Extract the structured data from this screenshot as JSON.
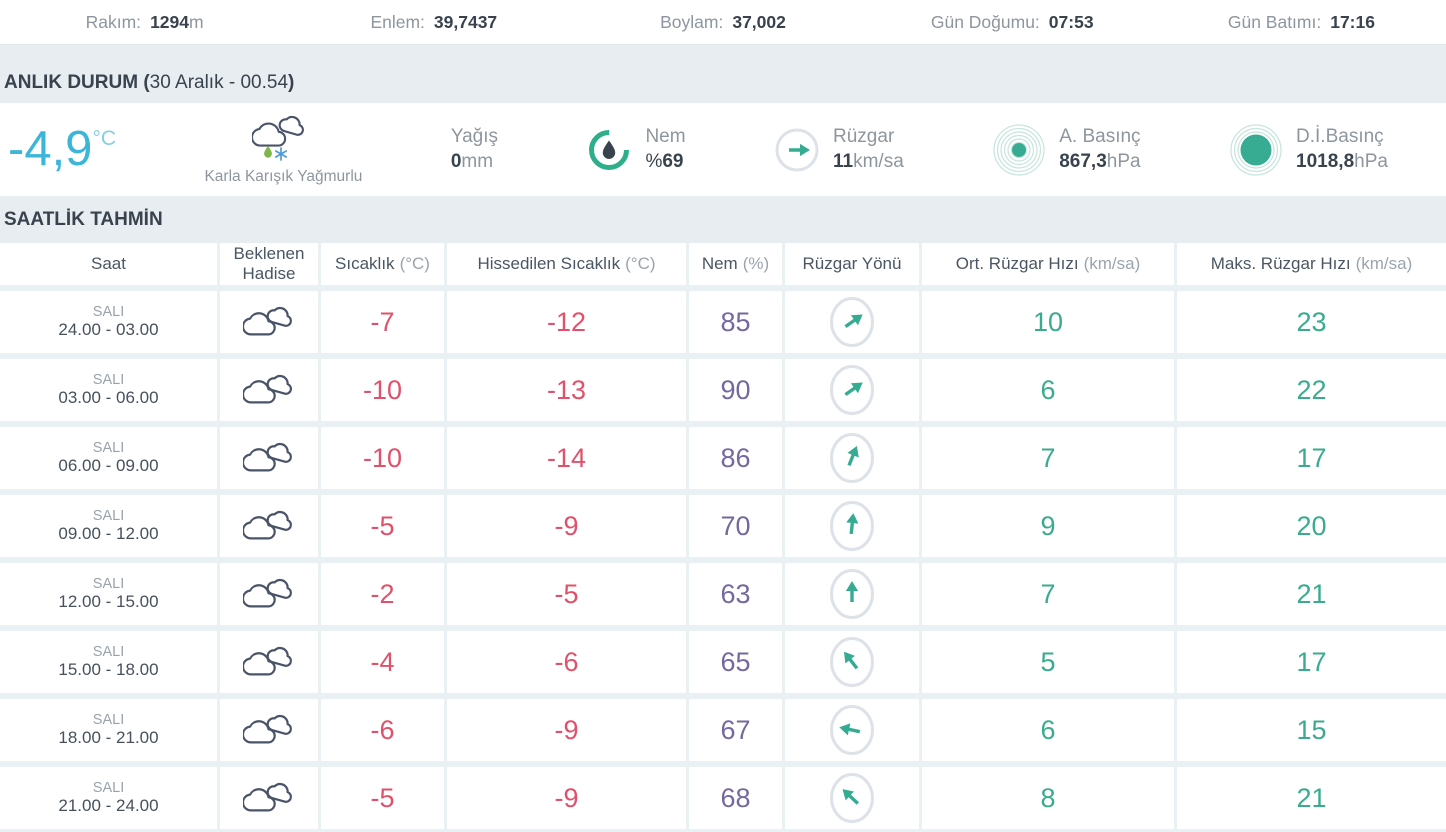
{
  "topbar": {
    "items": [
      {
        "label": "Rakım:",
        "value": "1294",
        "unit": "m"
      },
      {
        "label": "Enlem:",
        "value": "39,7437",
        "unit": ""
      },
      {
        "label": "Boylam:",
        "value": "37,002",
        "unit": ""
      },
      {
        "label": "Gün Doğumu:",
        "value": "07:53",
        "unit": ""
      },
      {
        "label": "Gün Batımı:",
        "value": "17:16",
        "unit": ""
      }
    ]
  },
  "current": {
    "section_prefix": "ANLIK DURUM (",
    "section_time": "30 Aralık - 00.54",
    "section_suffix": ")",
    "temperature": "-4,9",
    "temperature_unit": "°C",
    "condition": "Karla Karışık Yağmurlu",
    "condition_icon": "sleet-clouds-icon",
    "precip": {
      "label": "Yağış",
      "value": "0",
      "unit": "mm"
    },
    "humidity": {
      "label": "Nem",
      "prefix": "%",
      "value": "69",
      "icon": "humidity-gauge-icon"
    },
    "wind": {
      "label": "Rüzgar",
      "value": "11",
      "unit": "km/sa",
      "dir_deg": 90,
      "icon": "wind-direction-icon"
    },
    "pressure": {
      "label": "A. Basınç",
      "value": "867,3",
      "unit": "hPa",
      "icon": "station-pressure-icon"
    },
    "sea_pressure": {
      "label": "D.İ.Basınç",
      "value": "1018,8",
      "unit": "hPa",
      "icon": "sea-level-pressure-icon"
    }
  },
  "hourly": {
    "section_title": "SAATLİK TAHMİN",
    "columns": [
      {
        "label": "Saat",
        "unit": ""
      },
      {
        "label": "Beklenen Hadise",
        "unit": ""
      },
      {
        "label": "Sıcaklık",
        "unit": "(°C)"
      },
      {
        "label": "Hissedilen Sıcaklık",
        "unit": "(°C)"
      },
      {
        "label": "Nem",
        "unit": "(%)"
      },
      {
        "label": "Rüzgar Yönü",
        "unit": ""
      },
      {
        "label": "Ort. Rüzgar Hızı",
        "unit": "(km/sa)"
      },
      {
        "label": "Maks. Rüzgar Hızı",
        "unit": "(km/sa)"
      }
    ],
    "rows": [
      {
        "day": "SALI",
        "time": "24.00 - 03.00",
        "icon": "mostly-cloudy",
        "temp": "-7",
        "feels": "-12",
        "humidity": "85",
        "wind_dir_deg": 55,
        "avg_wind": "10",
        "max_wind": "23"
      },
      {
        "day": "SALI",
        "time": "03.00 - 06.00",
        "icon": "mostly-cloudy",
        "temp": "-10",
        "feels": "-13",
        "humidity": "90",
        "wind_dir_deg": 55,
        "avg_wind": "6",
        "max_wind": "22"
      },
      {
        "day": "SALI",
        "time": "06.00 - 09.00",
        "icon": "mostly-cloudy",
        "temp": "-10",
        "feels": "-14",
        "humidity": "86",
        "wind_dir_deg": 22,
        "avg_wind": "7",
        "max_wind": "17"
      },
      {
        "day": "SALI",
        "time": "09.00 - 12.00",
        "icon": "mostly-cloudy",
        "temp": "-5",
        "feels": "-9",
        "humidity": "70",
        "wind_dir_deg": 6,
        "avg_wind": "9",
        "max_wind": "20"
      },
      {
        "day": "SALI",
        "time": "12.00 - 15.00",
        "icon": "mostly-cloudy",
        "temp": "-2",
        "feels": "-5",
        "humidity": "63",
        "wind_dir_deg": 0,
        "avg_wind": "7",
        "max_wind": "21"
      },
      {
        "day": "SALI",
        "time": "15.00 - 18.00",
        "icon": "mostly-cloudy",
        "temp": "-4",
        "feels": "-6",
        "humidity": "65",
        "wind_dir_deg": -38,
        "avg_wind": "5",
        "max_wind": "17"
      },
      {
        "day": "SALI",
        "time": "18.00 - 21.00",
        "icon": "mostly-cloudy",
        "temp": "-6",
        "feels": "-9",
        "humidity": "67",
        "wind_dir_deg": -78,
        "avg_wind": "6",
        "max_wind": "15"
      },
      {
        "day": "SALI",
        "time": "21.00 - 24.00",
        "icon": "mostly-cloudy",
        "temp": "-5",
        "feels": "-9",
        "humidity": "68",
        "wind_dir_deg": -47,
        "avg_wind": "8",
        "max_wind": "21"
      }
    ]
  },
  "colors": {
    "accent_cyan": "#3bb6d8",
    "accent_red": "#e0516b",
    "accent_purple": "#75689f",
    "accent_teal": "#36ab90",
    "band_bg": "#e7edf1",
    "text_dark": "#39434e",
    "text_gray": "#8d969e"
  }
}
